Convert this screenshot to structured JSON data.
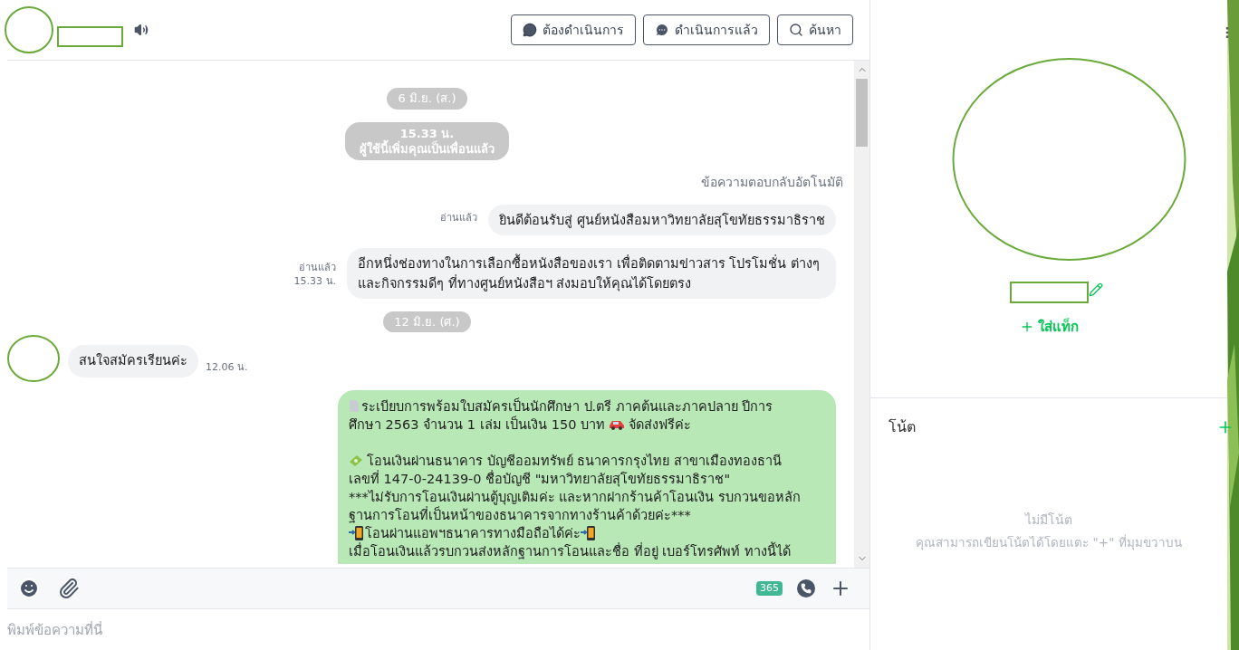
{
  "header": {
    "buttons": [
      {
        "kind": "todo",
        "label": "ต้องดำเนินการ"
      },
      {
        "kind": "done",
        "label": "ดำเนินการแล้ว"
      },
      {
        "kind": "search",
        "label": "ค้นหา"
      }
    ]
  },
  "messages": [
    {
      "kind": "date",
      "text": "6 มิ.ย. (ส.)"
    },
    {
      "kind": "system",
      "lines": [
        "15.33 น.",
        "ผู้ใช้นี้เพิ่มคุณเป็นเพื่อนแล้ว"
      ]
    },
    {
      "kind": "label",
      "text": "ข้อความตอบกลับอัตโนมัติ"
    },
    {
      "kind": "out",
      "meta": [
        "อ่านแล้ว"
      ],
      "text": "ยินดีต้อนรับสู่ ศูนย์หนังสือมหาวิทยาลัยสุโขทัยธรรมาธิราช"
    },
    {
      "kind": "out",
      "meta": [
        "อ่านแล้ว",
        "15.33 น."
      ],
      "text": "อีกหนึ่งช่องทางในการเลือกซื้อหนังสือของเรา เพื่อติดตามข่าวสาร โปรโมชั่น ต่างๆ และกิจกรรมดีๆ ที่ทางศูนย์หนังสือฯ ส่งมอบให้คุณได้โดยตรง"
    },
    {
      "kind": "date",
      "text": "12 มิ.ย. (ศ.)"
    },
    {
      "kind": "in",
      "text": "สนใจสมัครเรียนค่ะ",
      "time": "12.06 น."
    },
    {
      "kind": "rich",
      "lines": [
        [
          {
            "kind": "doc"
          },
          {
            "kind": "text",
            "text": "ระเบียบการพร้อมใบสมัครเป็นนักศึกษา ป.ตรี ภาคต้นและภาคปลาย ปีการ"
          }
        ],
        [
          {
            "kind": "text",
            "text": "ศึกษา 2563 จำนวน 1 เล่ม เป็นเงิน 150 บาท"
          },
          {
            "kind": "car"
          },
          {
            "kind": "text",
            "text": "จัดส่งฟรีค่ะ"
          }
        ],
        [
          {
            "kind": "blank"
          }
        ],
        [
          {
            "kind": "money"
          },
          {
            "kind": "text",
            "text": "โอนเงินผ่านธนาคาร บัญชีออมทรัพย์ ธนาคารกรุงไทย สาขาเมืองทองธานี"
          }
        ],
        [
          {
            "kind": "text",
            "text": "เลขที่ 147-0-24139-0 ชื่อบัญชี \"มหาวิทยาลัยสุโขทัยธรรมาธิราช\""
          }
        ],
        [
          {
            "kind": "text",
            "text": "***ไม่รับการโอนเงินผ่านตู้บุญเติมค่ะ และหากฝากร้านค้าโอนเงิน รบกวนขอหลัก"
          }
        ],
        [
          {
            "kind": "text",
            "text": "ฐานการโอนที่เป็นหน้าของธนาคารจากทางร้านค้าด้วยค่ะ***"
          }
        ],
        [
          {
            "kind": "phone"
          },
          {
            "kind": "text",
            "text": "โอนผ่านแอพฯธนาคารทางมือถือได้ค่ะ"
          },
          {
            "kind": "phone"
          }
        ],
        [
          {
            "kind": "text",
            "text": "เมื่อโอนเงินแล้วรบกวนส่งหลักฐานการโอนและชื่อ ที่อยู่ เบอร์โทรศัพท์ ทางนี้ได้"
          }
        ]
      ]
    }
  ],
  "toolbar": {
    "badge": "365"
  },
  "composer": {
    "placeholder": "พิมพ์ข้อความที่นี่"
  },
  "profile": {
    "add_tag": "ใส่แท็ก"
  },
  "notes": {
    "title": "โน้ต",
    "empty_title": "ไม่มีโน้ต",
    "empty_hint": "คุณสามารถเขียนโน้ตได้โดยแตะ \"+\" ที่มุมขวาบน"
  }
}
